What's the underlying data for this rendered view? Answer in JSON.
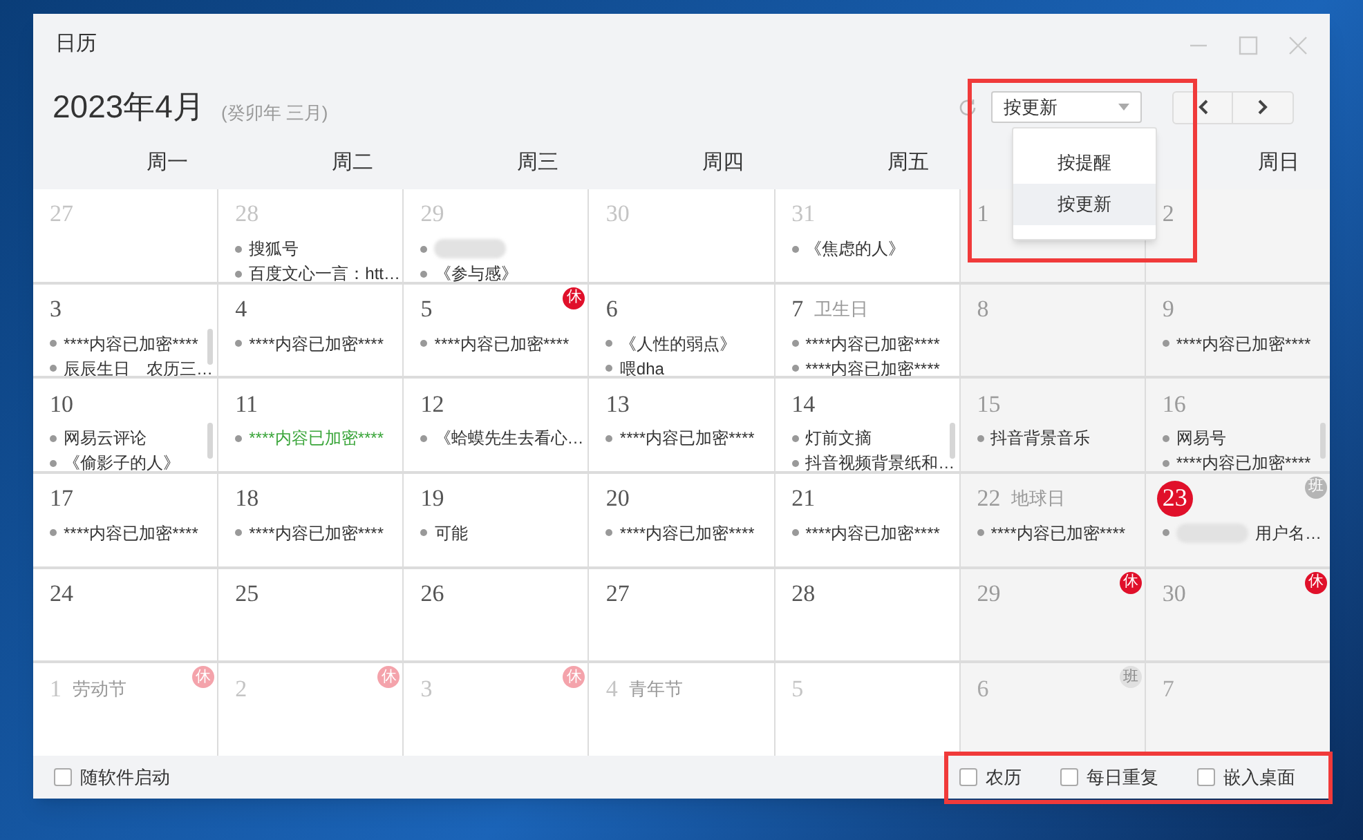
{
  "window": {
    "title": "日历"
  },
  "header": {
    "month": "2023年4月",
    "lunar": "(癸卯年 三月)"
  },
  "toolbar": {
    "select": {
      "value": "按更新",
      "expanded": true,
      "options": [
        {
          "label": "按提醒",
          "selected": false
        },
        {
          "label": "按更新",
          "selected": true
        }
      ]
    }
  },
  "weekdays": [
    "周一",
    "周二",
    "周三",
    "周四",
    "周五",
    "周日"
  ],
  "weeks": [
    [
      {
        "day": "27",
        "dim": true,
        "weekend": false
      },
      {
        "day": "28",
        "dim": true,
        "weekend": false,
        "items": [
          {
            "kind": "text",
            "text": "搜狐号"
          },
          {
            "kind": "text",
            "text": "百度文心一言：htt…"
          }
        ]
      },
      {
        "day": "29",
        "dim": true,
        "weekend": false,
        "items": [
          {
            "kind": "blurred"
          },
          {
            "kind": "text",
            "text": "《参与感》"
          }
        ]
      },
      {
        "day": "30",
        "dim": true,
        "weekend": false
      },
      {
        "day": "31",
        "dim": true,
        "weekend": false,
        "items": [
          {
            "kind": "text",
            "text": "《焦虑的人》"
          }
        ]
      },
      {
        "day": "1",
        "dim": false,
        "weekend": true
      },
      {
        "day": "2",
        "dim": false,
        "weekend": true
      }
    ],
    [
      {
        "day": "3",
        "dim": false,
        "weekend": false,
        "scrollable": true,
        "items": [
          {
            "kind": "text",
            "text": "****内容已加密****"
          },
          {
            "kind": "text",
            "text": "辰辰生日　农历三…"
          }
        ]
      },
      {
        "day": "4",
        "dim": false,
        "weekend": false,
        "items": [
          {
            "kind": "text",
            "text": "****内容已加密****"
          }
        ]
      },
      {
        "day": "5",
        "dim": false,
        "weekend": false,
        "badge": {
          "kind": "rest",
          "text": "休"
        },
        "items": [
          {
            "kind": "text",
            "text": "****内容已加密****"
          }
        ]
      },
      {
        "day": "6",
        "dim": false,
        "weekend": false,
        "items": [
          {
            "kind": "text",
            "text": "《人性的弱点》"
          },
          {
            "kind": "text",
            "text": "喂dha"
          }
        ]
      },
      {
        "day": "7",
        "festival": "卫生日",
        "dim": false,
        "weekend": false,
        "items": [
          {
            "kind": "text",
            "text": "****内容已加密****"
          },
          {
            "kind": "text",
            "text": "****内容已加密****"
          }
        ]
      },
      {
        "day": "8",
        "dim": false,
        "weekend": true
      },
      {
        "day": "9",
        "dim": false,
        "weekend": true,
        "items": [
          {
            "kind": "text",
            "text": "****内容已加密****"
          }
        ]
      }
    ],
    [
      {
        "day": "10",
        "dim": false,
        "weekend": false,
        "scrollable": true,
        "items": [
          {
            "kind": "text",
            "text": "网易云评论"
          },
          {
            "kind": "text",
            "text": "《偷影子的人》"
          }
        ]
      },
      {
        "day": "11",
        "dim": false,
        "weekend": false,
        "items": [
          {
            "kind": "text",
            "text": "****内容已加密****",
            "color": "#3aa53a"
          }
        ]
      },
      {
        "day": "12",
        "dim": false,
        "weekend": false,
        "items": [
          {
            "kind": "text",
            "text": "《蛤蟆先生去看心…"
          }
        ]
      },
      {
        "day": "13",
        "dim": false,
        "weekend": false,
        "items": [
          {
            "kind": "text",
            "text": "****内容已加密****"
          }
        ]
      },
      {
        "day": "14",
        "dim": false,
        "weekend": false,
        "scrollable": true,
        "items": [
          {
            "kind": "text",
            "text": "灯前文摘"
          },
          {
            "kind": "text",
            "text": "抖音视频背景纸和…"
          }
        ]
      },
      {
        "day": "15",
        "dim": false,
        "weekend": true,
        "items": [
          {
            "kind": "text",
            "text": "抖音背景音乐"
          }
        ]
      },
      {
        "day": "16",
        "dim": false,
        "weekend": true,
        "scrollable": true,
        "items": [
          {
            "kind": "text",
            "text": "网易号"
          },
          {
            "kind": "text",
            "text": "****内容已加密****"
          }
        ]
      }
    ],
    [
      {
        "day": "17",
        "dim": false,
        "weekend": false,
        "items": [
          {
            "kind": "text",
            "text": "****内容已加密****"
          }
        ]
      },
      {
        "day": "18",
        "dim": false,
        "weekend": false,
        "items": [
          {
            "kind": "text",
            "text": "****内容已加密****"
          }
        ]
      },
      {
        "day": "19",
        "dim": false,
        "weekend": false,
        "items": [
          {
            "kind": "text",
            "text": "可能"
          }
        ]
      },
      {
        "day": "20",
        "dim": false,
        "weekend": false,
        "items": [
          {
            "kind": "text",
            "text": "****内容已加密****"
          }
        ]
      },
      {
        "day": "21",
        "dim": false,
        "weekend": false,
        "items": [
          {
            "kind": "text",
            "text": "****内容已加密****"
          }
        ]
      },
      {
        "day": "22",
        "festival": "地球日",
        "dim": false,
        "weekend": true,
        "items": [
          {
            "kind": "text",
            "text": "****内容已加密****"
          }
        ]
      },
      {
        "day": "23",
        "today": true,
        "dim": false,
        "weekend": true,
        "badge": {
          "kind": "work",
          "text": "班"
        },
        "items": [
          {
            "kind": "blurred",
            "text": "用户名…"
          }
        ]
      }
    ],
    [
      {
        "day": "24",
        "dim": false,
        "weekend": false
      },
      {
        "day": "25",
        "dim": false,
        "weekend": false
      },
      {
        "day": "26",
        "dim": false,
        "weekend": false
      },
      {
        "day": "27",
        "dim": false,
        "weekend": false
      },
      {
        "day": "28",
        "dim": false,
        "weekend": false
      },
      {
        "day": "29",
        "dim": false,
        "weekend": true,
        "badge": {
          "kind": "rest",
          "text": "休"
        }
      },
      {
        "day": "30",
        "dim": false,
        "weekend": true,
        "badge": {
          "kind": "rest",
          "text": "休"
        }
      }
    ],
    [
      {
        "day": "1",
        "festival": "劳动节",
        "dim": true,
        "weekend": false,
        "badge": {
          "kind": "rest",
          "text": "休"
        }
      },
      {
        "day": "2",
        "dim": true,
        "weekend": false,
        "badge": {
          "kind": "rest",
          "text": "休"
        }
      },
      {
        "day": "3",
        "dim": true,
        "weekend": false,
        "badge": {
          "kind": "rest",
          "text": "休"
        }
      },
      {
        "day": "4",
        "festival": "青年节",
        "dim": true,
        "weekend": false
      },
      {
        "day": "5",
        "dim": true,
        "weekend": false
      },
      {
        "day": "6",
        "dim": true,
        "weekend": true,
        "badge": {
          "kind": "work",
          "text": "班"
        }
      },
      {
        "day": "7",
        "dim": true,
        "weekend": true
      }
    ]
  ],
  "footer": {
    "left": [
      {
        "label": "随软件启动",
        "checked": false
      }
    ],
    "right": [
      {
        "label": "农历",
        "checked": false
      },
      {
        "label": "每日重复",
        "checked": false
      },
      {
        "label": "嵌入桌面",
        "checked": false
      }
    ]
  }
}
